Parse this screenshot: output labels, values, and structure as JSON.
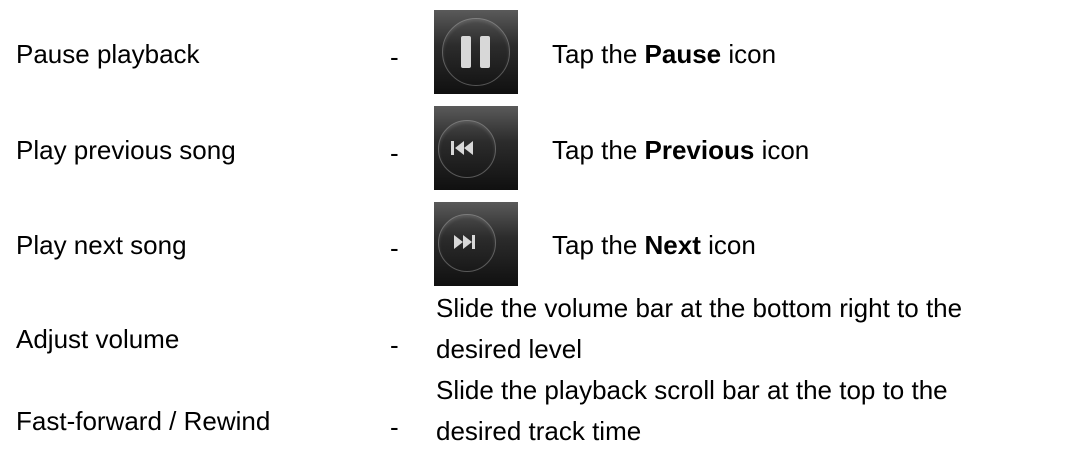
{
  "rows": [
    {
      "action": "Pause playback",
      "dash": "-",
      "icon": "pause-icon",
      "desc_prefix": "Tap the ",
      "desc_bold": "Pause",
      "desc_suffix": " icon"
    },
    {
      "action": "Play previous song",
      "dash": "-",
      "icon": "previous-icon",
      "desc_prefix": "Tap the ",
      "desc_bold": "Previous",
      "desc_suffix": " icon"
    },
    {
      "action": "Play next song",
      "dash": "-",
      "icon": "next-icon",
      "desc_prefix": "Tap the ",
      "desc_bold": "Next",
      "desc_suffix": " icon"
    },
    {
      "action": "Adjust volume",
      "dash": "-",
      "desc_line1": "Slide the volume bar at the bottom right to the",
      "desc_line2": "desired level"
    },
    {
      "action": "Fast-forward / Rewind",
      "dash": "-",
      "desc_line1": "Slide the playback scroll bar at the top to the",
      "desc_line2": "desired track time"
    }
  ]
}
